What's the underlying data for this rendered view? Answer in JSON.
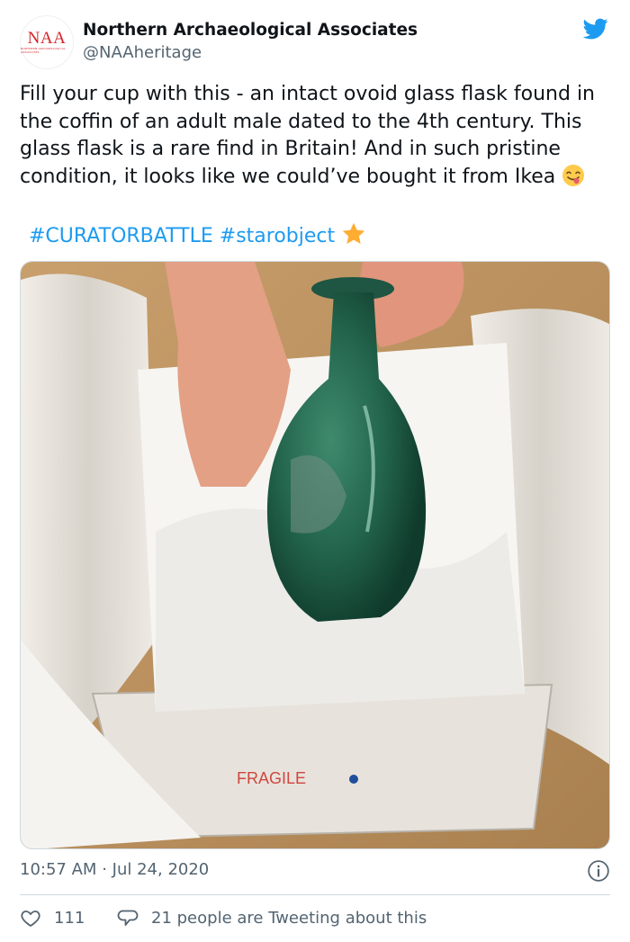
{
  "account": {
    "display_name": "Northern Archaeological Associates",
    "handle": "@NAAheritage",
    "avatar_text": "NAA",
    "avatar_subtext": "NORTHERN ARCHAEOLOGICAL ASSOCIATES"
  },
  "tweet": {
    "text": "Fill your cup with this - an intact ovoid glass flask found in the coffin of an adult male dated to the 4th century. This glass flask is a rare find in Britain! And in such pristine condition, it looks like we could’ve bought it from Ikea",
    "hashtags": [
      "#CURATORBATTLE",
      "#starobject"
    ],
    "emoji_after_text": "yum-face-emoji",
    "emoji_after_hashtags": "star-emoji",
    "box_label": "FRAGILE"
  },
  "meta": {
    "time": "10:57 AM",
    "separator": "·",
    "date": "Jul 24, 2020"
  },
  "engagement": {
    "likes": "111",
    "tweeting_text": "21 people are Tweeting about this"
  },
  "colors": {
    "link": "#1d9bf0",
    "secondary_text": "#536471",
    "brand_red": "#d6232a",
    "twitter_blue": "#1d9bf0"
  }
}
